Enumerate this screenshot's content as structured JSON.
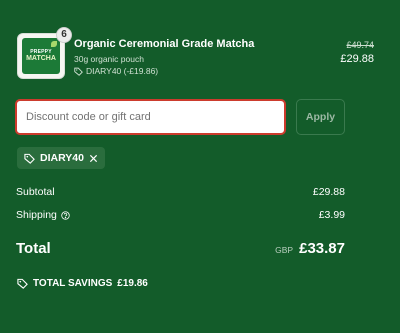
{
  "item": {
    "quantity": "6",
    "thumb_brand": "PREPPY",
    "thumb_name": "MATCHA",
    "title": "Organic Ceremonial Grade Matcha",
    "variant": "30g organic pouch",
    "discount_line": "DIARY40 (-£19.86)",
    "price_original": "£49.74",
    "price_final": "£29.88"
  },
  "discount": {
    "placeholder": "Discount code or gift card",
    "apply_label": "Apply",
    "applied_code": "DIARY40"
  },
  "summary": {
    "subtotal_label": "Subtotal",
    "subtotal_value": "£29.88",
    "shipping_label": "Shipping",
    "shipping_value": "£3.99",
    "total_label": "Total",
    "currency": "GBP",
    "total_value": "£33.87",
    "savings_label": "TOTAL SAVINGS",
    "savings_value": "£19.86"
  },
  "colors": {
    "background": "#135c2a",
    "input_border_error": "#cc3b2d",
    "chip_background": "#2a6d3d"
  },
  "icons": {
    "discount_tag": "tag-icon",
    "remove_code": "close-icon",
    "shipping_info": "question-circle-icon",
    "savings": "tag-icon"
  }
}
